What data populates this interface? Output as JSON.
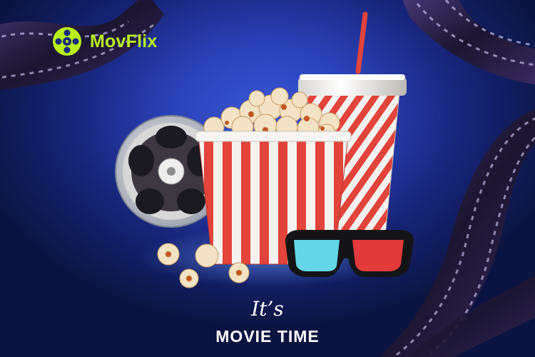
{
  "brand": {
    "name": "MovFlix",
    "accent_color": "#b8f01a",
    "logo_icon": "film-reel-icon"
  },
  "headline": {
    "script_text": "It’s",
    "main_text": "MOVIE TIME"
  },
  "illustration": {
    "items": [
      "film-reel-icon",
      "popcorn-bucket-icon",
      "soda-cup-icon",
      "3d-glasses-icon",
      "film-strip-icon"
    ],
    "colors": {
      "background": "#2a3fb4",
      "stripe_red": "#e2433a",
      "stripe_white": "#f4f2ee",
      "glasses_left": "#63d6e8",
      "glasses_right": "#e23a3a"
    }
  }
}
